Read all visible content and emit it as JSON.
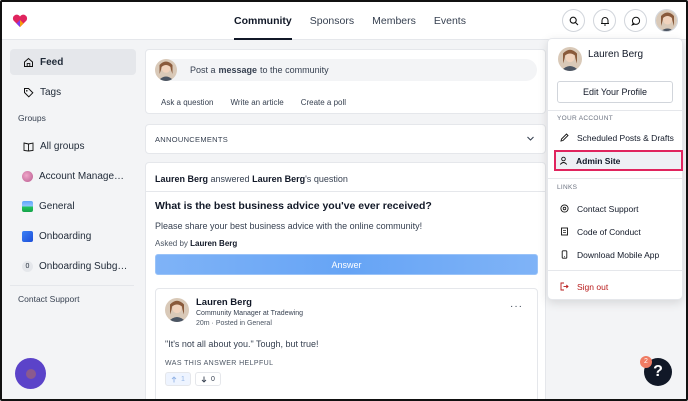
{
  "nav": {
    "items": [
      "Community",
      "Sponsors",
      "Members",
      "Events"
    ],
    "active": "Community"
  },
  "sidebar": {
    "feed": "Feed",
    "tags": "Tags",
    "groups_heading": "Groups",
    "groups": [
      {
        "label": "All groups",
        "icon": "book-icon"
      },
      {
        "label": "Account Manage…",
        "icon": "brain-emoji-icon"
      },
      {
        "label": "General",
        "icon": "landscape-emoji-icon"
      },
      {
        "label": "Onboarding",
        "icon": "chart-emoji-icon"
      },
      {
        "label": "Onboarding Subg…",
        "icon": "zero-badge",
        "badge": "0"
      }
    ],
    "contact_support": "Contact Support"
  },
  "composer": {
    "prefix": "Post a",
    "bold": "message",
    "suffix": "to the community",
    "actions": [
      "Ask a question",
      "Write an article",
      "Create a poll"
    ]
  },
  "announcements": {
    "title": "ANNOUNCEMENTS"
  },
  "question": {
    "author": "Lauren Berg",
    "verb": "answered",
    "target": "Lauren Berg",
    "target_suffix": "'s question",
    "title": "What is the best business advice you've ever received?",
    "body": "Please share your best business advice with the online community!",
    "asked_by_label": "Asked by",
    "asked_by": "Lauren Berg",
    "answer_button": "Answer"
  },
  "answer": {
    "name": "Lauren Berg",
    "role": "Community Manager at Tradewing",
    "meta": "20m · Posted in General",
    "text": "\"It's not all about you.\" Tough, but true!",
    "helpful_label": "WAS THIS ANSWER HELPFUL",
    "upvotes": "1",
    "downvotes": "0"
  },
  "dropdown": {
    "name": "Lauren Berg",
    "edit_profile": "Edit Your Profile",
    "your_account_heading": "YOUR ACCOUNT",
    "scheduled": "Scheduled Posts & Drafts",
    "admin_site": "Admin Site",
    "links_heading": "LINKS",
    "contact_support": "Contact Support",
    "code_of_conduct": "Code of Conduct",
    "download_app": "Download Mobile App",
    "sign_out": "Sign out"
  },
  "help": {
    "badge": "2",
    "label": "?"
  },
  "colors": {
    "accent_highlight": "#e0245e",
    "answer_button": "#6ea8fe",
    "launcher": "#5b43c9",
    "sign_out": "#b91c1c"
  }
}
